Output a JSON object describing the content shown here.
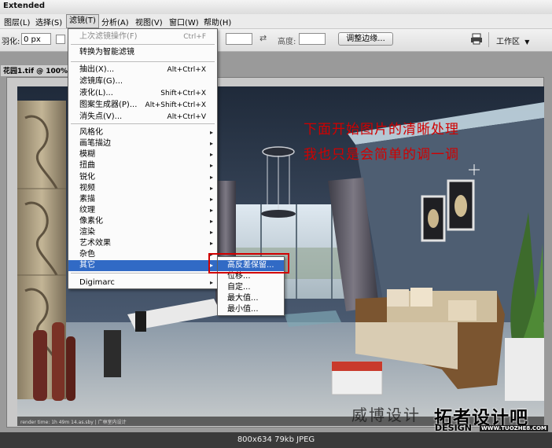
{
  "window": {
    "title": "Extended"
  },
  "menubar": {
    "items": [
      "图层(L)",
      "选择(S)",
      "滤镜(T)",
      "分析(A)",
      "视图(V)",
      "窗口(W)",
      "帮助(H)"
    ]
  },
  "options": {
    "feather_label": "羽化:",
    "feather_value": "0 px",
    "height_label": "高度:",
    "refine_edge_button": "调整边缘...",
    "workspace_label": "工作区",
    "workspace_arrow": "▼"
  },
  "document": {
    "tab_title": "花园1.tif @ 100%"
  },
  "filter_menu": {
    "items": [
      {
        "label": "上次滤镜操作(F)",
        "shortcut": "Ctrl+F",
        "disabled": true
      },
      {
        "label": "转换为智能滤镜"
      },
      {
        "label": "抽出(X)...",
        "shortcut": "Alt+Ctrl+X"
      },
      {
        "label": "滤镜库(G)..."
      },
      {
        "label": "液化(L)...",
        "shortcut": "Shift+Ctrl+X"
      },
      {
        "label": "图案生成器(P)...",
        "shortcut": "Alt+Shift+Ctrl+X"
      },
      {
        "label": "消失点(V)...",
        "shortcut": "Alt+Ctrl+V"
      },
      {
        "label": "风格化",
        "submenu": true
      },
      {
        "label": "画笔描边",
        "submenu": true
      },
      {
        "label": "模糊",
        "submenu": true
      },
      {
        "label": "扭曲",
        "submenu": true
      },
      {
        "label": "锐化",
        "submenu": true
      },
      {
        "label": "视频",
        "submenu": true
      },
      {
        "label": "素描",
        "submenu": true
      },
      {
        "label": "纹理",
        "submenu": true
      },
      {
        "label": "像素化",
        "submenu": true
      },
      {
        "label": "渲染",
        "submenu": true
      },
      {
        "label": "艺术效果",
        "submenu": true
      },
      {
        "label": "杂色",
        "submenu": true
      },
      {
        "label": "其它",
        "submenu": true,
        "highlighted": true
      },
      {
        "label": "Digimarc",
        "submenu": true
      }
    ],
    "arrow": "▸"
  },
  "other_submenu": {
    "items": [
      "高反差保留...",
      "位移...",
      "自定...",
      "最大值...",
      "最小值..."
    ],
    "selected_index": 0
  },
  "annotation": {
    "line1": "下面开始图片的清晰处理",
    "line2": "我也只是会简单的调一调",
    "color": "#d10000"
  },
  "render_caption": "render time: 1h 49m 14.as.sby | 广林室内设计",
  "watermark": {
    "brand": "拓者设计吧",
    "url": "WWW.TUOZHE8.COM",
    "design": "DESIGN",
    "signature": "威博设计"
  },
  "statusbar": {
    "text": "800x634  79kb  JPEG"
  },
  "colors": {
    "highlight": "#316ac5",
    "annotation_box": "#d10000"
  }
}
